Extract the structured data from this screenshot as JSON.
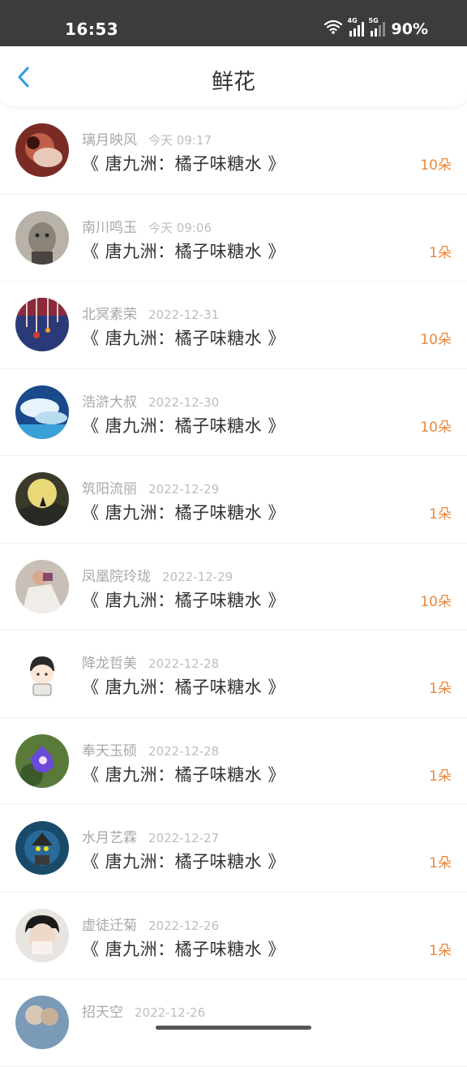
{
  "status_bar": {
    "time": "16:53",
    "battery": "90%",
    "network1": "4G",
    "network2": "5G"
  },
  "header": {
    "title": "鲜花"
  },
  "records": [
    {
      "user": "璃月映风",
      "time": "今天 09:17",
      "book": "《 唐九洲：橘子味糖水 》",
      "count": "10朵"
    },
    {
      "user": "南川鸣玉",
      "time": "今天 09:06",
      "book": "《 唐九洲：橘子味糖水 》",
      "count": "1朵"
    },
    {
      "user": "北冥素荣",
      "time": "2022-12-31",
      "book": "《 唐九洲：橘子味糖水 》",
      "count": "10朵"
    },
    {
      "user": "浩滸大叔",
      "time": "2022-12-30",
      "book": "《 唐九洲：橘子味糖水 》",
      "count": "10朵"
    },
    {
      "user": "筑阳流丽",
      "time": "2022-12-29",
      "book": "《 唐九洲：橘子味糖水 》",
      "count": "1朵"
    },
    {
      "user": "凤凰院玲珑",
      "time": "2022-12-29",
      "book": "《 唐九洲：橘子味糖水 》",
      "count": "10朵"
    },
    {
      "user": "降龙哲美",
      "time": "2022-12-28",
      "book": "《 唐九洲：橘子味糖水 》",
      "count": "1朵"
    },
    {
      "user": "奉天玉硕",
      "time": "2022-12-28",
      "book": "《 唐九洲：橘子味糖水 》",
      "count": "1朵"
    },
    {
      "user": "水月艺霖",
      "time": "2022-12-27",
      "book": "《 唐九洲：橘子味糖水 》",
      "count": "1朵"
    },
    {
      "user": "虚徒迁菊",
      "time": "2022-12-26",
      "book": "《 唐九洲：橘子味糖水 》",
      "count": "1朵"
    },
    {
      "user": "招天空",
      "time": "2022-12-26",
      "book": "",
      "count": ""
    }
  ],
  "colors": {
    "accent": "#2f9be0",
    "count": "#e8883c",
    "status_bar": "#3c3c3c"
  }
}
